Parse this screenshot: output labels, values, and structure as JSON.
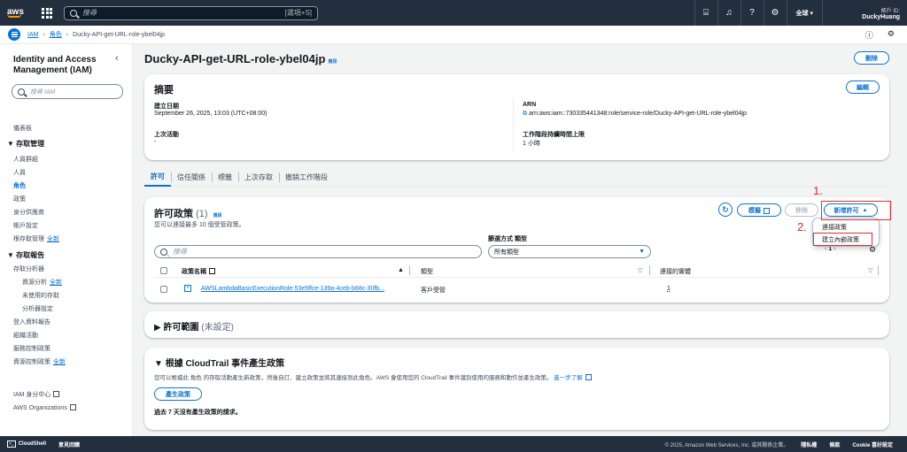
{
  "topbar": {
    "logo": "aws",
    "search_placeholder": "搜尋",
    "search_shortcut": "[選項+S]",
    "region": "全球 ▾",
    "account_id_label": "帳戶 ID: ",
    "account_user": "DuckyHuang"
  },
  "breadcrumb": {
    "items": [
      "IAM",
      "角色"
    ],
    "current": "Ducky-API-get-URL-role-ybel04jp"
  },
  "sidenav": {
    "title": "Identity and Access Management (IAM)",
    "search_placeholder": "搜尋 IAM",
    "dashboard": "儀表板",
    "access_mgmt": "▼ 存取管理",
    "user_groups": "人員群組",
    "users": "人員",
    "roles": "角色",
    "policies": "政策",
    "identity_providers": "身分供應商",
    "account_settings": "帳戶設定",
    "root_access": "根存取管理",
    "new_tag": "全新",
    "access_reports": "▼ 存取報告",
    "access_analyzer": "存取分析器",
    "resource_analysis": "資源分析",
    "unused_access": "未使用的存取",
    "analyzer_settings": "分析器設定",
    "credential_report": "登入資料報告",
    "org_activity": "組織活動",
    "scp": "服務控制政策",
    "rcp": "資源控制政策",
    "identity_center": "IAM 身分中心",
    "aws_orgs": "AWS Organizations"
  },
  "page": {
    "title": "Ducky-API-get-URL-role-ybel04jp",
    "info": "資訊",
    "delete": "刪除"
  },
  "summary": {
    "title": "摘要",
    "edit": "編輯",
    "created_label": "建立日期",
    "created_value": "September 26, 2025, 13:03 (UTC+08:00)",
    "last_activity_label": "上次活動",
    "last_activity_value": "-",
    "arn_label": "ARN",
    "arn_value": "arn:aws:iam::730335441348:role/service-role/Ducky-API-get-URL-role-ybel04jp",
    "max_session_label": "工作階段持續時間上限",
    "max_session_value": "1 小時"
  },
  "tabs": [
    "許可",
    "信任關係",
    "標籤",
    "上次存取",
    "撤銷工作階段"
  ],
  "permissions": {
    "title": "許可政策",
    "count": "(1)",
    "info": "資訊",
    "subtitle": "您可以連接最多 10 個受管政策。",
    "simulate": "模擬",
    "remove": "移除",
    "add_permissions": "新增許可",
    "filter_label": "篩選方式 類型",
    "search_placeholder": "搜尋",
    "type_filter": "所有類型",
    "page": "1",
    "columns": [
      "政策名稱",
      "類型",
      "連接的實體"
    ],
    "rows": [
      {
        "name": "AWSLambdaBasicExecutionRole-53e5ffce-139a-4ceb-b68c-30fb...",
        "type": "客戶受管",
        "attached": "1"
      }
    ],
    "dropdown": [
      "連接政策",
      "建立內嵌政策"
    ]
  },
  "annotations": {
    "one": "1.",
    "two": "2."
  },
  "boundary": {
    "title": "許可範圍",
    "state": "(未設定)"
  },
  "cloudtrail": {
    "title": "根據 CloudTrail 事件產生政策",
    "desc": "您可以根據此 角色 的存取活動產生新政策，然後自訂、建立政策並將其連接到此角色。AWS 會使用您的 CloudTrail 事件識別使用的服務和動作並產生政策。",
    "learn_more": "進一步了解",
    "generate": "產生政策",
    "no_requests": "過去 7 天沒有產生政策的請求。"
  },
  "footer": {
    "cloudshell": "CloudShell",
    "feedback": "意見回饋",
    "copyright": "© 2025, Amazon Web Services, Inc. 或其關係企業。",
    "privacy": "隱私權",
    "terms": "條款",
    "cookies": "Cookie 喜好設定"
  },
  "colors": {
    "accent": "#0972d3",
    "annotation": "#e32b2b",
    "nav_bg": "#232f3e"
  }
}
